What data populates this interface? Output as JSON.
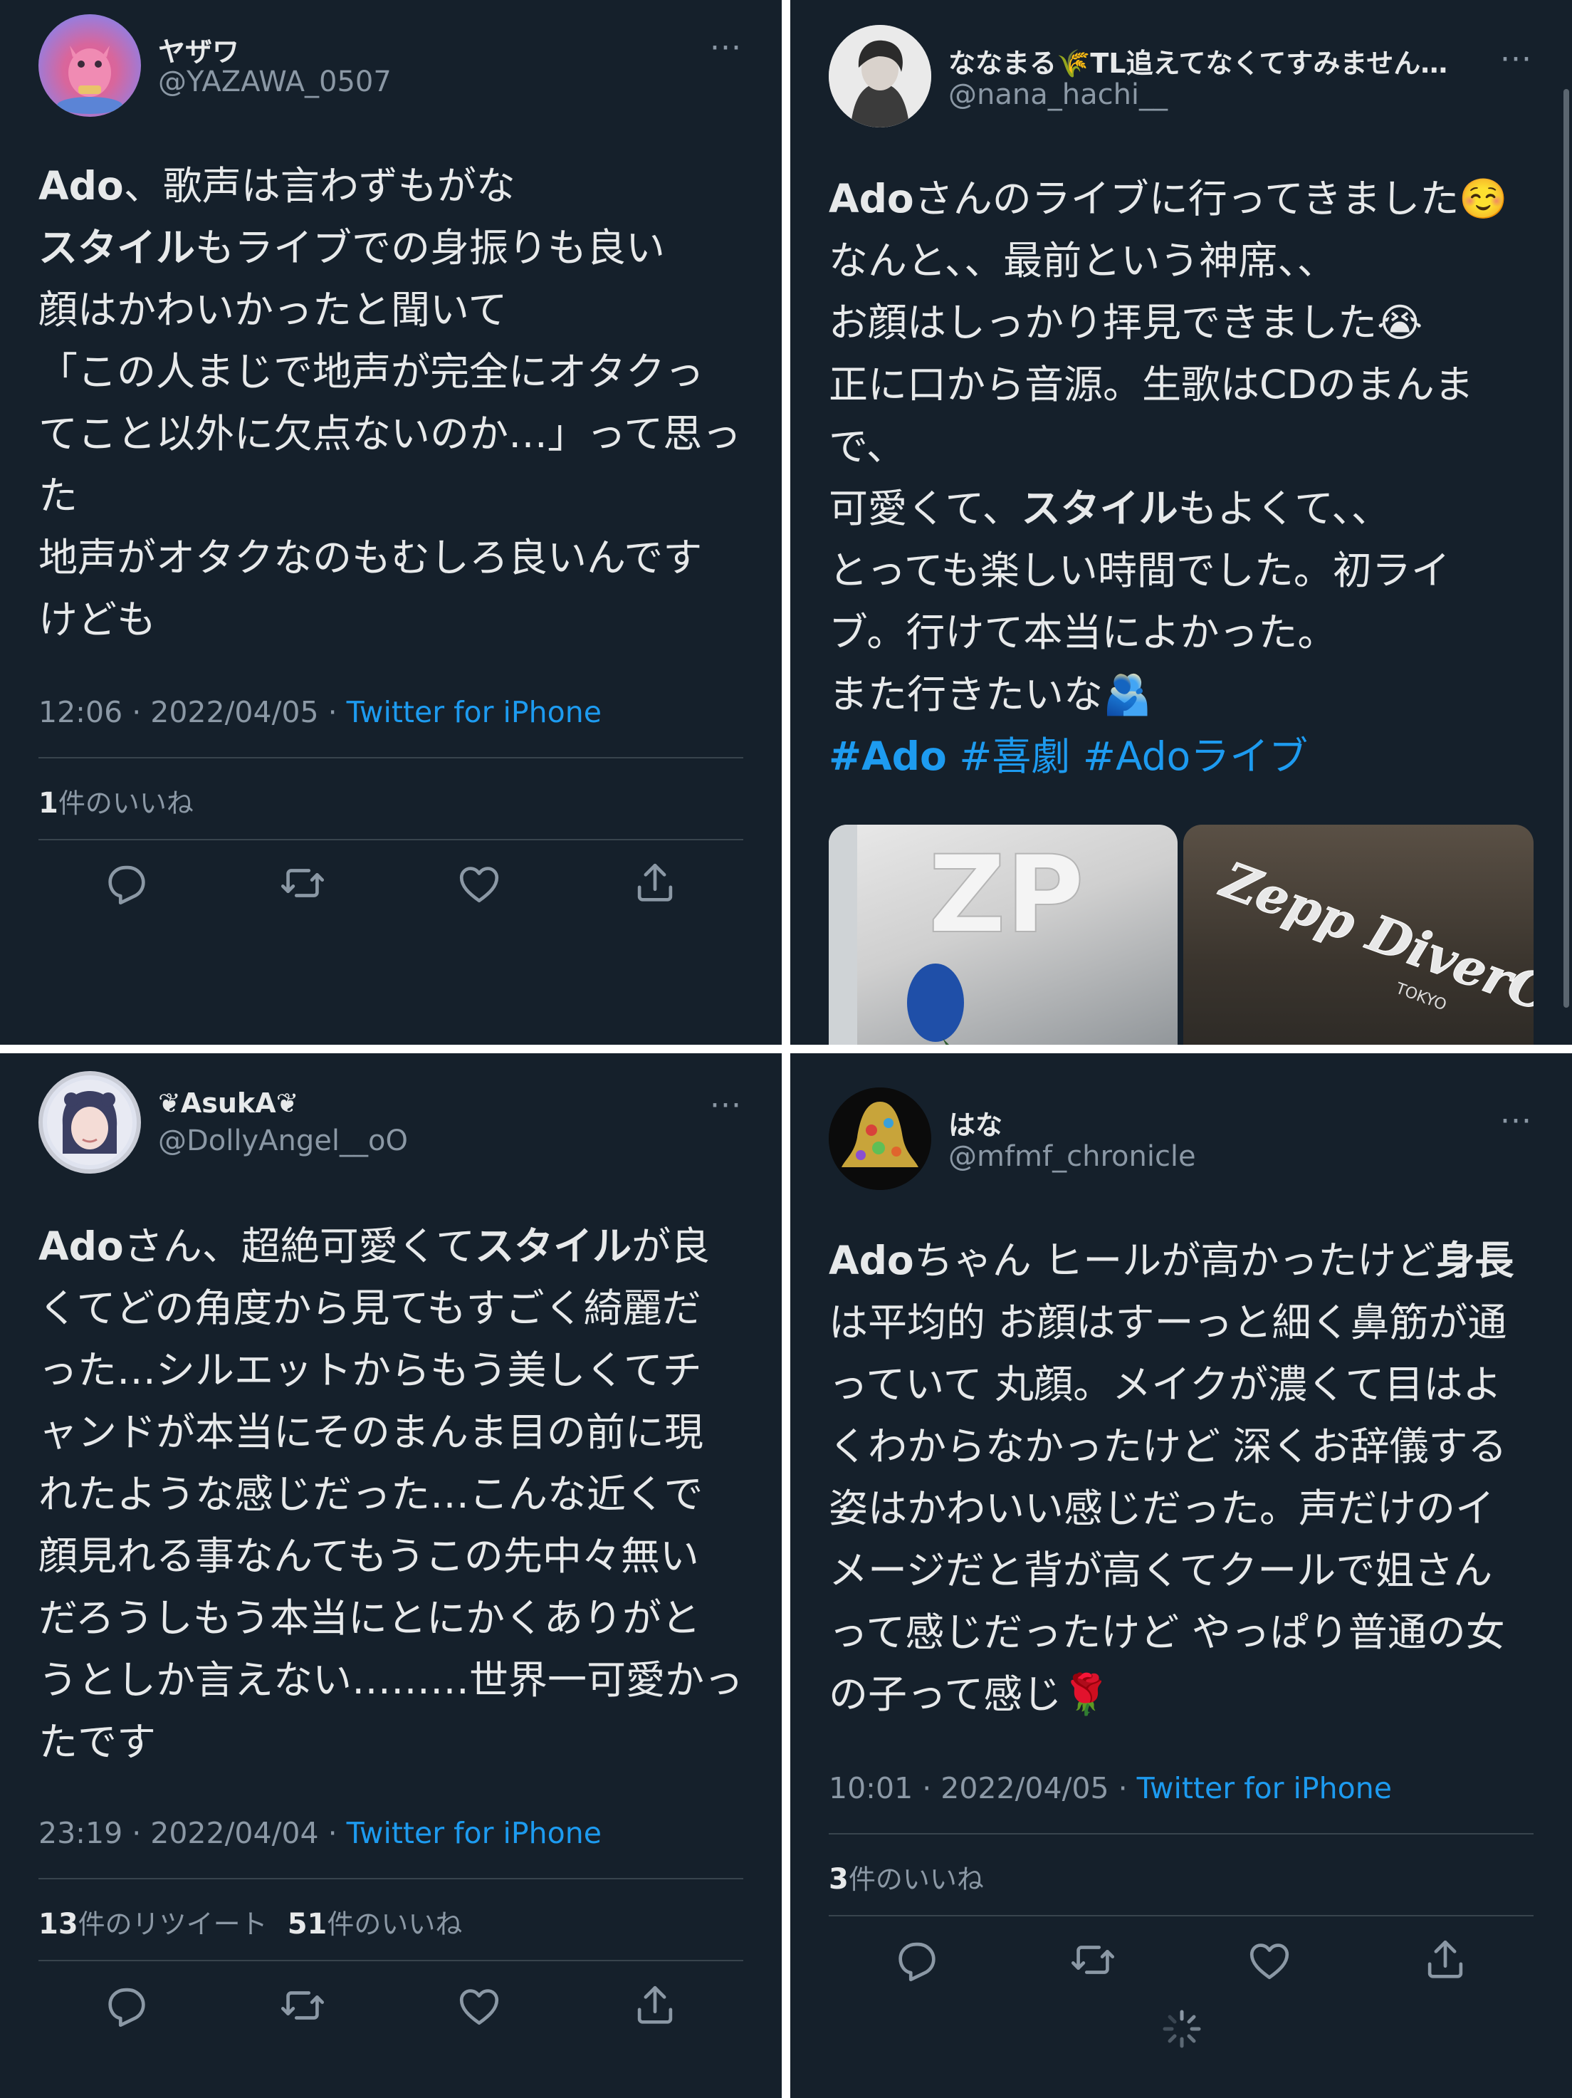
{
  "tweets": [
    {
      "display_name": "ヤザワ",
      "handle": "@YAZAWA_0507",
      "body": [
        "Ado、歌声は言わずもがな",
        "スタイルもライブでの身振りも良い",
        "顔はかわいかったと聞いて",
        "「この人まじで地声が完全にオタクっ",
        "てこと以外に欠点ないのか…」って思っ",
        "た",
        "地声がオタクなのもむしろ良いんです",
        "けども"
      ],
      "time_date": "12:06 · 2022/04/05 · ",
      "source": "Twitter for iPhone",
      "likes_count": "1",
      "likes_label": "件のいいね"
    },
    {
      "display_name": "ななまる🌾TL追えてなくてすみません…",
      "handle": "@nana_hachi__",
      "body": [
        "Adoさんのライブに行ってきました☺️",
        "なんと、、最前という神席、、",
        "お顔はしっかり拝見できました😭",
        "正に口から音源。生歌はCDのまんま",
        "で、",
        "可愛くて、スタイルもよくて、、",
        "とっても楽しい時間でした。初ライ",
        "ブ。行けて本当によかった。",
        "また行きたいな🫂"
      ],
      "hashtags": [
        "#Ado",
        "#喜劇",
        "#Adoライブ"
      ],
      "media": [
        "Zepp DiverCity TOKYO",
        "Zepp DiverCity TOKYO"
      ]
    },
    {
      "display_name": "❦AsukA❦",
      "handle": "@DollyAngel__oO",
      "body": [
        "Adoさん、超絶可愛くてスタイルが良",
        "くてどの角度から見てもすごく綺麗だ",
        "った…シルエットからもう美しくてチ",
        "ャンドが本当にそのまんま目の前に現",
        "れたような感じだった…こんな近くで",
        "顔見れる事なんてもうこの先中々無い",
        "だろうしもう本当にとにかくありがと",
        "うとしか言えない………世界一可愛かっ",
        "たです"
      ],
      "time_date": "23:19 · 2022/04/04 · ",
      "source": "Twitter for iPhone",
      "retweets_count": "13",
      "retweets_label": "件のリツイート",
      "likes_count": "51",
      "likes_label": "件のいいね"
    },
    {
      "display_name": "はな",
      "handle": "@mfmf_chronicle",
      "body": [
        "Adoちゃん ヒールが高かったけど身長",
        "は平均的 お顔はすーっと細く鼻筋が通",
        "っていて 丸顔。メイクが濃くて目はよ",
        "くわからなかったけど 深くお辞儀する",
        "姿はかわいい感じだった。声だけのイ",
        "メージだと背が高くてクールで姐さん",
        "って感じだったけど やっぱり普通の女",
        "の子って感じ🌹"
      ],
      "time_date": "10:01 · 2022/04/05 · ",
      "source": "Twitter for iPhone",
      "likes_count": "3",
      "likes_label": "件のいいね"
    }
  ],
  "more_icon": "···",
  "icons": [
    "reply-icon",
    "retweet-icon",
    "like-icon",
    "share-icon",
    "loading-spinner-icon"
  ],
  "colors": {
    "background": "#15202b",
    "text": "#e7e9ea",
    "secondary": "#8b98a5",
    "link": "#1d9bf0",
    "divider": "#38444d"
  }
}
